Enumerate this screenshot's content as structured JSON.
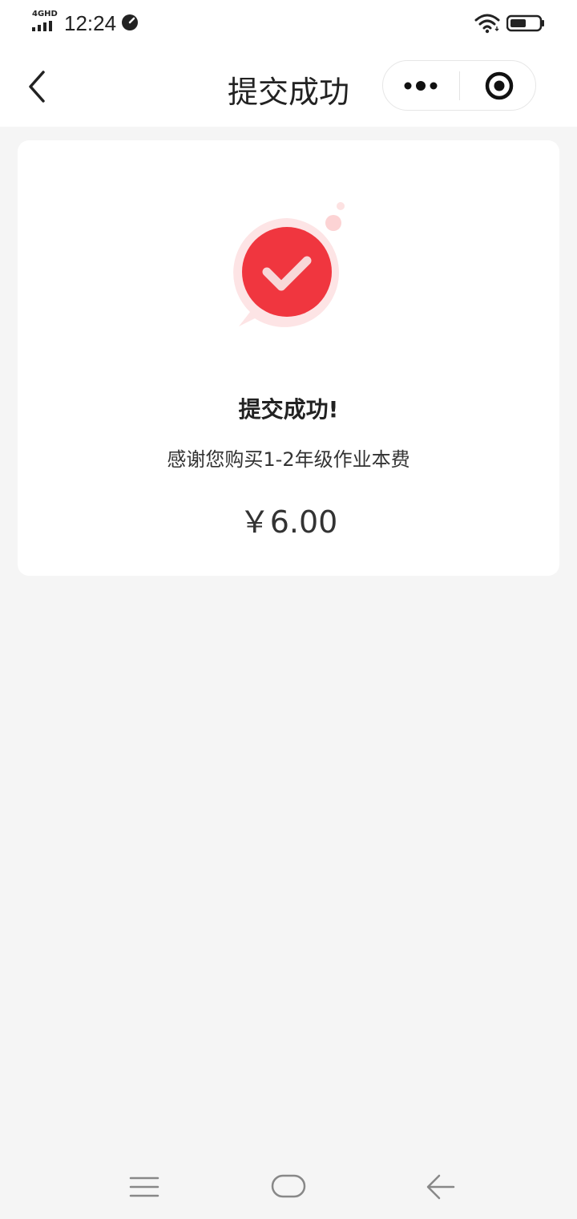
{
  "status_bar": {
    "network": "4GHD",
    "time": "12:24",
    "battery_percent": 55
  },
  "nav": {
    "title": "提交成功"
  },
  "result": {
    "title": "提交成功!",
    "description": "感谢您购买1-2年级作业本费",
    "amount": "￥6.00"
  },
  "colors": {
    "accent_red": "#f0363f",
    "background": "#f5f5f5",
    "card": "#ffffff"
  },
  "icons": [
    "back-chevron-icon",
    "more-dots-icon",
    "close-target-icon",
    "check-bubble-icon",
    "menu-icon",
    "home-icon",
    "back-arrow-icon"
  ]
}
